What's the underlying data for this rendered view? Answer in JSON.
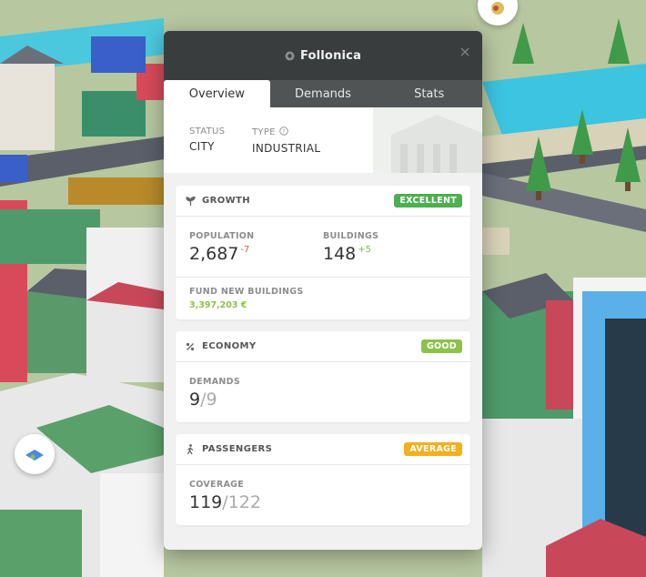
{
  "panel": {
    "title": "Follonica",
    "close_icon": "close-icon",
    "tabs": [
      {
        "label": "Overview",
        "active": true
      },
      {
        "label": "Demands",
        "active": false
      },
      {
        "label": "Stats",
        "active": false
      }
    ],
    "info": {
      "status_label": "STATUS",
      "status_value": "CITY",
      "type_label": "TYPE",
      "type_value": "INDUSTRIAL"
    }
  },
  "growth": {
    "title": "GROWTH",
    "badge": "EXCELLENT",
    "badge_color": "#4caf50",
    "population_label": "POPULATION",
    "population_value": "2,687",
    "population_delta": "-7",
    "buildings_label": "BUILDINGS",
    "buildings_value": "148",
    "buildings_delta": "+5",
    "fund_label": "FUND NEW BUILDINGS",
    "fund_value": "3,397,203 €"
  },
  "economy": {
    "title": "ECONOMY",
    "badge": "GOOD",
    "badge_color": "#8bc34a",
    "demands_label": "DEMANDS",
    "demands_value": "9",
    "demands_total": "/9"
  },
  "passengers": {
    "title": "PASSENGERS",
    "badge": "AVERAGE",
    "badge_color": "#f2b01e",
    "coverage_label": "COVERAGE",
    "coverage_value": "119",
    "coverage_total": "/122"
  }
}
